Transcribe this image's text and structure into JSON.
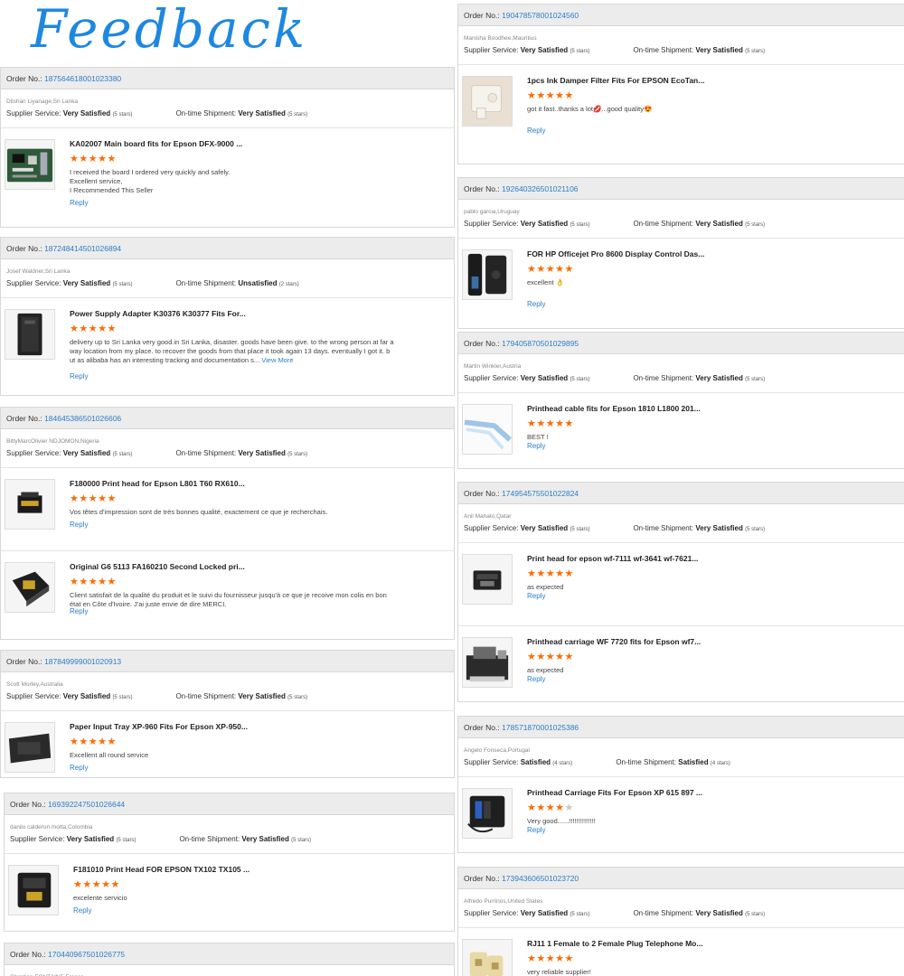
{
  "page": {
    "title": "Feedback"
  },
  "labels": {
    "order_no": "Order No.:",
    "supplier_service": "Supplier Service:",
    "ontime_shipment": "On-time Shipment:",
    "reply": "Reply",
    "view_more": "View More"
  },
  "colors": {
    "accent": "#1e88e0",
    "link": "#2a7ec9",
    "star_on": "#ff6a00",
    "star_off": "#c7c7c7",
    "header_bg": "#ececec"
  },
  "left": [
    {
      "order": "187564618001023380",
      "buyer": "Dilshan Liyanage,Sri Lanka",
      "supplier": "Very Satisfied",
      "supplier_stars": "(5 stars)",
      "shipment": "Very Satisfied",
      "shipment_stars": "(5 stars)",
      "items": [
        {
          "name": "KA02007 Main board fits for Epson DFX-9000 ...",
          "stars": 5,
          "thumb": "mainboard-thumbnail",
          "comment_lines": [
            "I received the board I ordered very quickly and safely.",
            "Excellent service,",
            "I Recommended This Seller"
          ]
        }
      ]
    },
    {
      "order": "187248414501026894",
      "buyer": "Josef Waldner,Sri Lanka",
      "supplier": "Very Satisfied",
      "supplier_stars": "(5 stars)",
      "shipment": "Unsatisfied",
      "shipment_stars": "(2 stars)",
      "items": [
        {
          "name": "Power Supply Adapter K30376 K30377 Fits For...",
          "stars": 5,
          "thumb": "power-supply-thumbnail",
          "comment_lines": [
            "delivery up to Sri Lanka very good.in Sri Lanka, disaster. goods have been give. to the wrong person at far a",
            "way location from my place. to recover the goods from that place it took again 13 days. eventually I got it. b",
            "ut as alibaba has an interesting tracking and documentation s..."
          ],
          "view_more": true
        }
      ]
    },
    {
      "order": "184645386501026606",
      "buyer": "BittyMarcOlivier NDJOMON,Nigeria",
      "supplier": "Very Satisfied",
      "supplier_stars": "(5 stars)",
      "shipment": "Very Satisfied",
      "shipment_stars": "(5 stars)",
      "items": [
        {
          "name": "F180000 Print head for Epson L801 T60 RX610...",
          "stars": 5,
          "thumb": "printhead-thumbnail",
          "comment_lines": [
            "Vos têtes d'impression sont de très bonnes qualité, exactement ce que je recherchais."
          ]
        },
        {
          "name": "Original G6 5113 FA160210 Second Locked pri...",
          "stars": 5,
          "thumb": "printhead-g6-thumbnail",
          "comment_lines": [
            "Client satisfait de la qualité du produit et le suivi du fournisseur jusqu'à ce que je recoive mon colis en bon",
            "état en Côte d'Ivoire. J'ai juste envie de dire MERCI."
          ]
        }
      ]
    },
    {
      "order": "187849999001020913",
      "buyer": "Scott Morley,Australia",
      "supplier": "Very Satisfied",
      "supplier_stars": "(5 stars)",
      "shipment": "Very Satisfied",
      "shipment_stars": "(5 stars)",
      "items": [
        {
          "name": "Paper Input Tray XP-960 Fits For Epson XP-950...",
          "stars": 5,
          "thumb": "paper-tray-thumbnail",
          "comment_lines": [
            "Excellent all round service"
          ]
        }
      ]
    },
    {
      "order": "169392247501026644",
      "buyer": "danilo calderon motta,Colombia",
      "supplier": "Very Satisfied",
      "supplier_stars": "(5 stars)",
      "shipment": "Very Satisfied",
      "shipment_stars": "(5 stars)",
      "items": [
        {
          "name": "F181010 Print Head FOR EPSON TX102 TX105 ...",
          "stars": 5,
          "thumb": "printhead-tx-thumbnail",
          "comment_lines": [
            "excelente servicio"
          ]
        }
      ]
    },
    {
      "order": "170440967501026775",
      "buyer": "Christian FONTAINE,France",
      "supplier": "",
      "supplier_stars": "",
      "shipment": "",
      "shipment_stars": "",
      "items": []
    }
  ],
  "right": [
    {
      "order": "190478578001024560",
      "buyer": "Manisha Boodhee,Mauritius",
      "supplier": "Very Satisfied",
      "supplier_stars": "(5 stars)",
      "shipment": "Very Satisfied",
      "shipment_stars": "(5 stars)",
      "items": [
        {
          "name": "1pcs Ink Damper Filter Fits For EPSON EcoTan...",
          "stars": 5,
          "thumb": "ink-damper-thumbnail",
          "comment_lines": [
            "got it fast..thanks a lot💋...good quality😍"
          ]
        }
      ]
    },
    {
      "order": "192640326501021106",
      "buyer": "pablo garcia,Uruguay",
      "supplier": "Very Satisfied",
      "supplier_stars": "(5 stars)",
      "shipment": "Very Satisfied",
      "shipment_stars": "(5 stars)",
      "items": [
        {
          "name": "FOR HP Officejet Pro 8600 Display Control Das...",
          "stars": 5,
          "thumb": "display-panel-thumbnail",
          "comment_lines": [
            "excellent 👌"
          ]
        }
      ]
    },
    {
      "order": "179405870501029895",
      "buyer": "Martin Winkler,Austria",
      "supplier": "Very Satisfied",
      "supplier_stars": "(5 stars)",
      "shipment": "Very Satisfied",
      "shipment_stars": "(5 stars)",
      "items": [
        {
          "name": "Printhead cable fits for Epson 1810 L1800 201...",
          "stars": 5,
          "thumb": "cable-thumbnail",
          "comment_lines": [
            "BEST !"
          ]
        }
      ]
    },
    {
      "order": "174954575501022824",
      "buyer": "Anil Mahato,Qatar",
      "supplier": "Very Satisfied",
      "supplier_stars": "(5 stars)",
      "shipment": "Very Satisfied",
      "shipment_stars": "(5 stars)",
      "items": [
        {
          "name": "Print head for epson wf-7111 wf-3641 wf-7621...",
          "stars": 5,
          "thumb": "printhead-wf-thumbnail",
          "comment_lines": [
            "as expected"
          ]
        },
        {
          "name": "Printhead carriage WF 7720 fits for Epson wf7...",
          "stars": 5,
          "thumb": "carriage-thumbnail",
          "comment_lines": [
            "as expected"
          ]
        }
      ]
    },
    {
      "order": "178571870001025386",
      "buyer": "Angelo Fonseca,Portugal",
      "supplier": "Satisfied",
      "supplier_stars": "(4 stars)",
      "shipment": "Satisfied",
      "shipment_stars": "(4 stars)",
      "items": [
        {
          "name": "Printhead Carriage Fits For Epson XP 615 897 ...",
          "stars": 4,
          "thumb": "carriage-xp-thumbnail",
          "comment_lines": [
            "Very good......!!!!!!!!!!!!!!"
          ]
        }
      ]
    },
    {
      "order": "173943606501023720",
      "buyer": "Alfredo Purrinos,United States",
      "supplier": "Very Satisfied",
      "supplier_stars": "(5 stars)",
      "shipment": "Very Satisfied",
      "shipment_stars": "(5 stars)",
      "items": [
        {
          "name": "RJ11 1 Female to 2 Female Plug Telephone Mo...",
          "stars": 5,
          "thumb": "rj11-adapter-thumbnail",
          "comment_lines": [
            "very reliable supplier!"
          ]
        }
      ]
    }
  ]
}
